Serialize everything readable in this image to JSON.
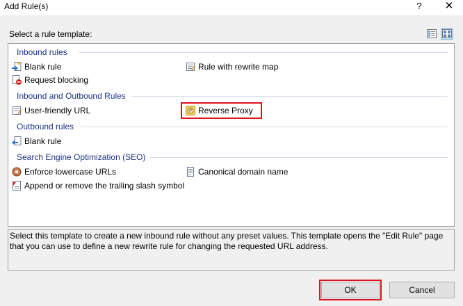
{
  "window": {
    "title": "Add Rule(s)",
    "help_glyph": "?",
    "close_glyph": "✕"
  },
  "select_label": "Select a rule template:",
  "view_modes": [
    "details-view-icon",
    "tiles-view-icon"
  ],
  "groups": {
    "inbound": {
      "header": "Inbound rules",
      "items": [
        "Blank rule",
        "Rule with rewrite map",
        "Request blocking"
      ]
    },
    "inbound_outbound": {
      "header": "Inbound and Outbound Rules",
      "items": [
        "User-friendly URL",
        "Reverse Proxy"
      ]
    },
    "outbound": {
      "header": "Outbound rules",
      "items": [
        "Blank rule"
      ]
    },
    "seo": {
      "header": "Search Engine Optimization (SEO)",
      "items": [
        "Enforce lowercase URLs",
        "Canonical domain name",
        "Append or remove the trailing slash symbol"
      ]
    }
  },
  "description": "Select this template to create a new inbound rule without any preset values. This template opens the \"Edit Rule\" page that you can use to define a new rewrite rule for changing the requested URL address.",
  "buttons": {
    "ok": "OK",
    "cancel": "Cancel"
  },
  "colors": {
    "group_header": "#1e3287",
    "highlight": "#e0101e"
  }
}
